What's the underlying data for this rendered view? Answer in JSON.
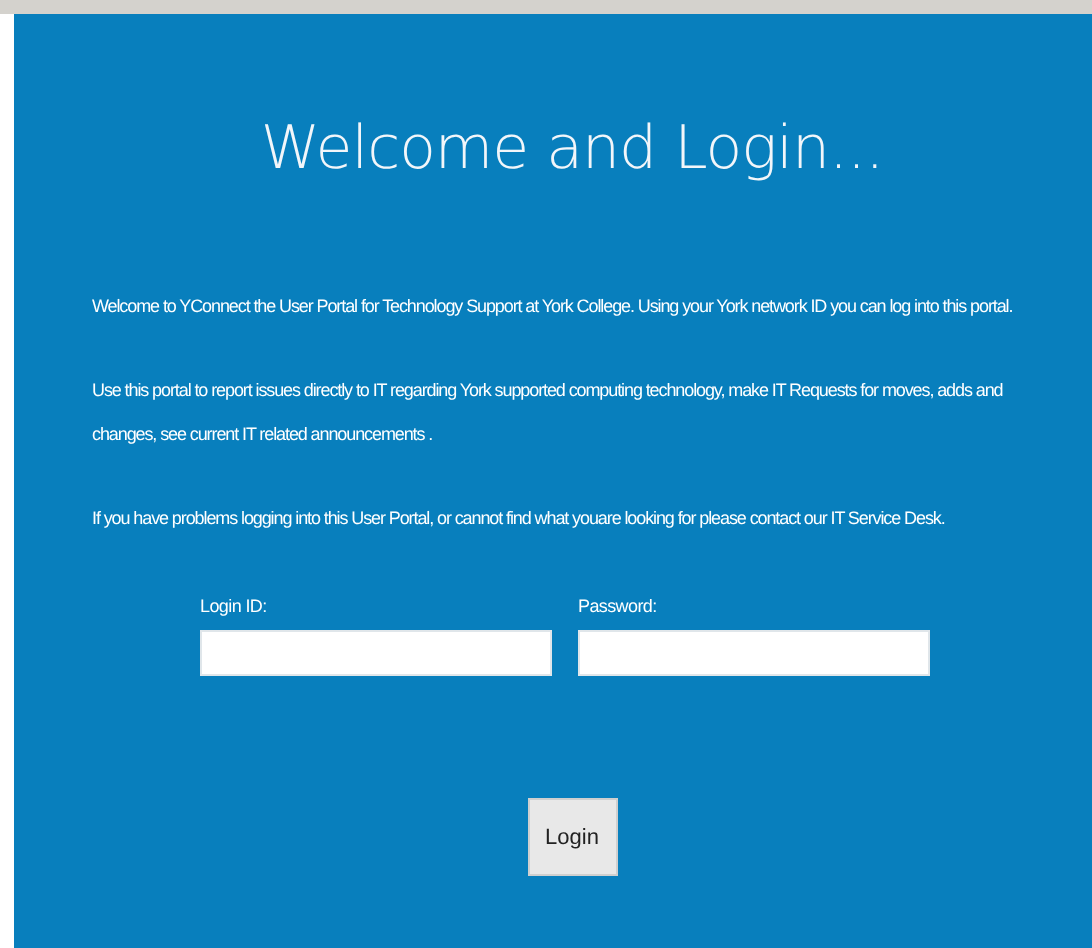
{
  "title": "Welcome and Login...",
  "paragraphs": [
    "Welcome to YConnect the User Portal for Technology Support at York College. Using your York network ID you can log into this portal.",
    "Use this portal to report issues directly to IT regarding York supported computing technology, make IT Requests for moves, adds and changes, see current IT related announcements .",
    "If you have problems logging into this User Portal, or cannot find what youare looking for please contact our IT Service Desk."
  ],
  "fields": [
    {
      "label": "Login ID:"
    },
    {
      "label": "Password:"
    }
  ],
  "button": "Login"
}
